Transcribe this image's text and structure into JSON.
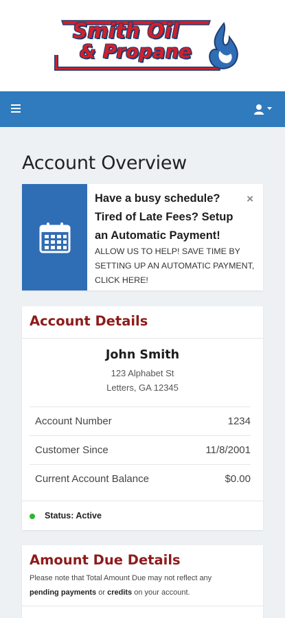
{
  "brand": {
    "line1": "Smith Oil",
    "line2": "& Propane",
    "colors": {
      "red": "#d31f2b",
      "navy": "#213d6e",
      "flame_blue": "#2f6db5"
    }
  },
  "navbar": {
    "menu_icon": "hamburger-menu-icon",
    "user_icon": "user-icon",
    "color": "#2f7bbd"
  },
  "page": {
    "title": "Account Overview"
  },
  "promo": {
    "icon": "calendar-icon",
    "heading": "Have a busy schedule? Tired of Late Fees? Setup an Automatic Payment!",
    "body": "Allow us to help! Save time by setting up an automatic payment, click here!",
    "close_label": "×"
  },
  "account_details": {
    "title": "Account Details",
    "name": "John Smith",
    "address_line1": "123 Alphabet St",
    "address_line2": "Letters, GA 12345",
    "rows": [
      {
        "label": "Account Number",
        "value": "1234"
      },
      {
        "label": "Customer Since",
        "value": "11/8/2001"
      },
      {
        "label": "Current Account Balance",
        "value": "$0.00"
      }
    ],
    "status": "Status: Active",
    "status_color": "#2cb52c"
  },
  "amount_due": {
    "title": "Amount Due Details",
    "note_pre": "Please note that Total Amount Due may not reflect any",
    "note_bold1": "pending payments",
    "note_mid": " or ",
    "note_bold2": "credits",
    "note_post": " on your account."
  }
}
